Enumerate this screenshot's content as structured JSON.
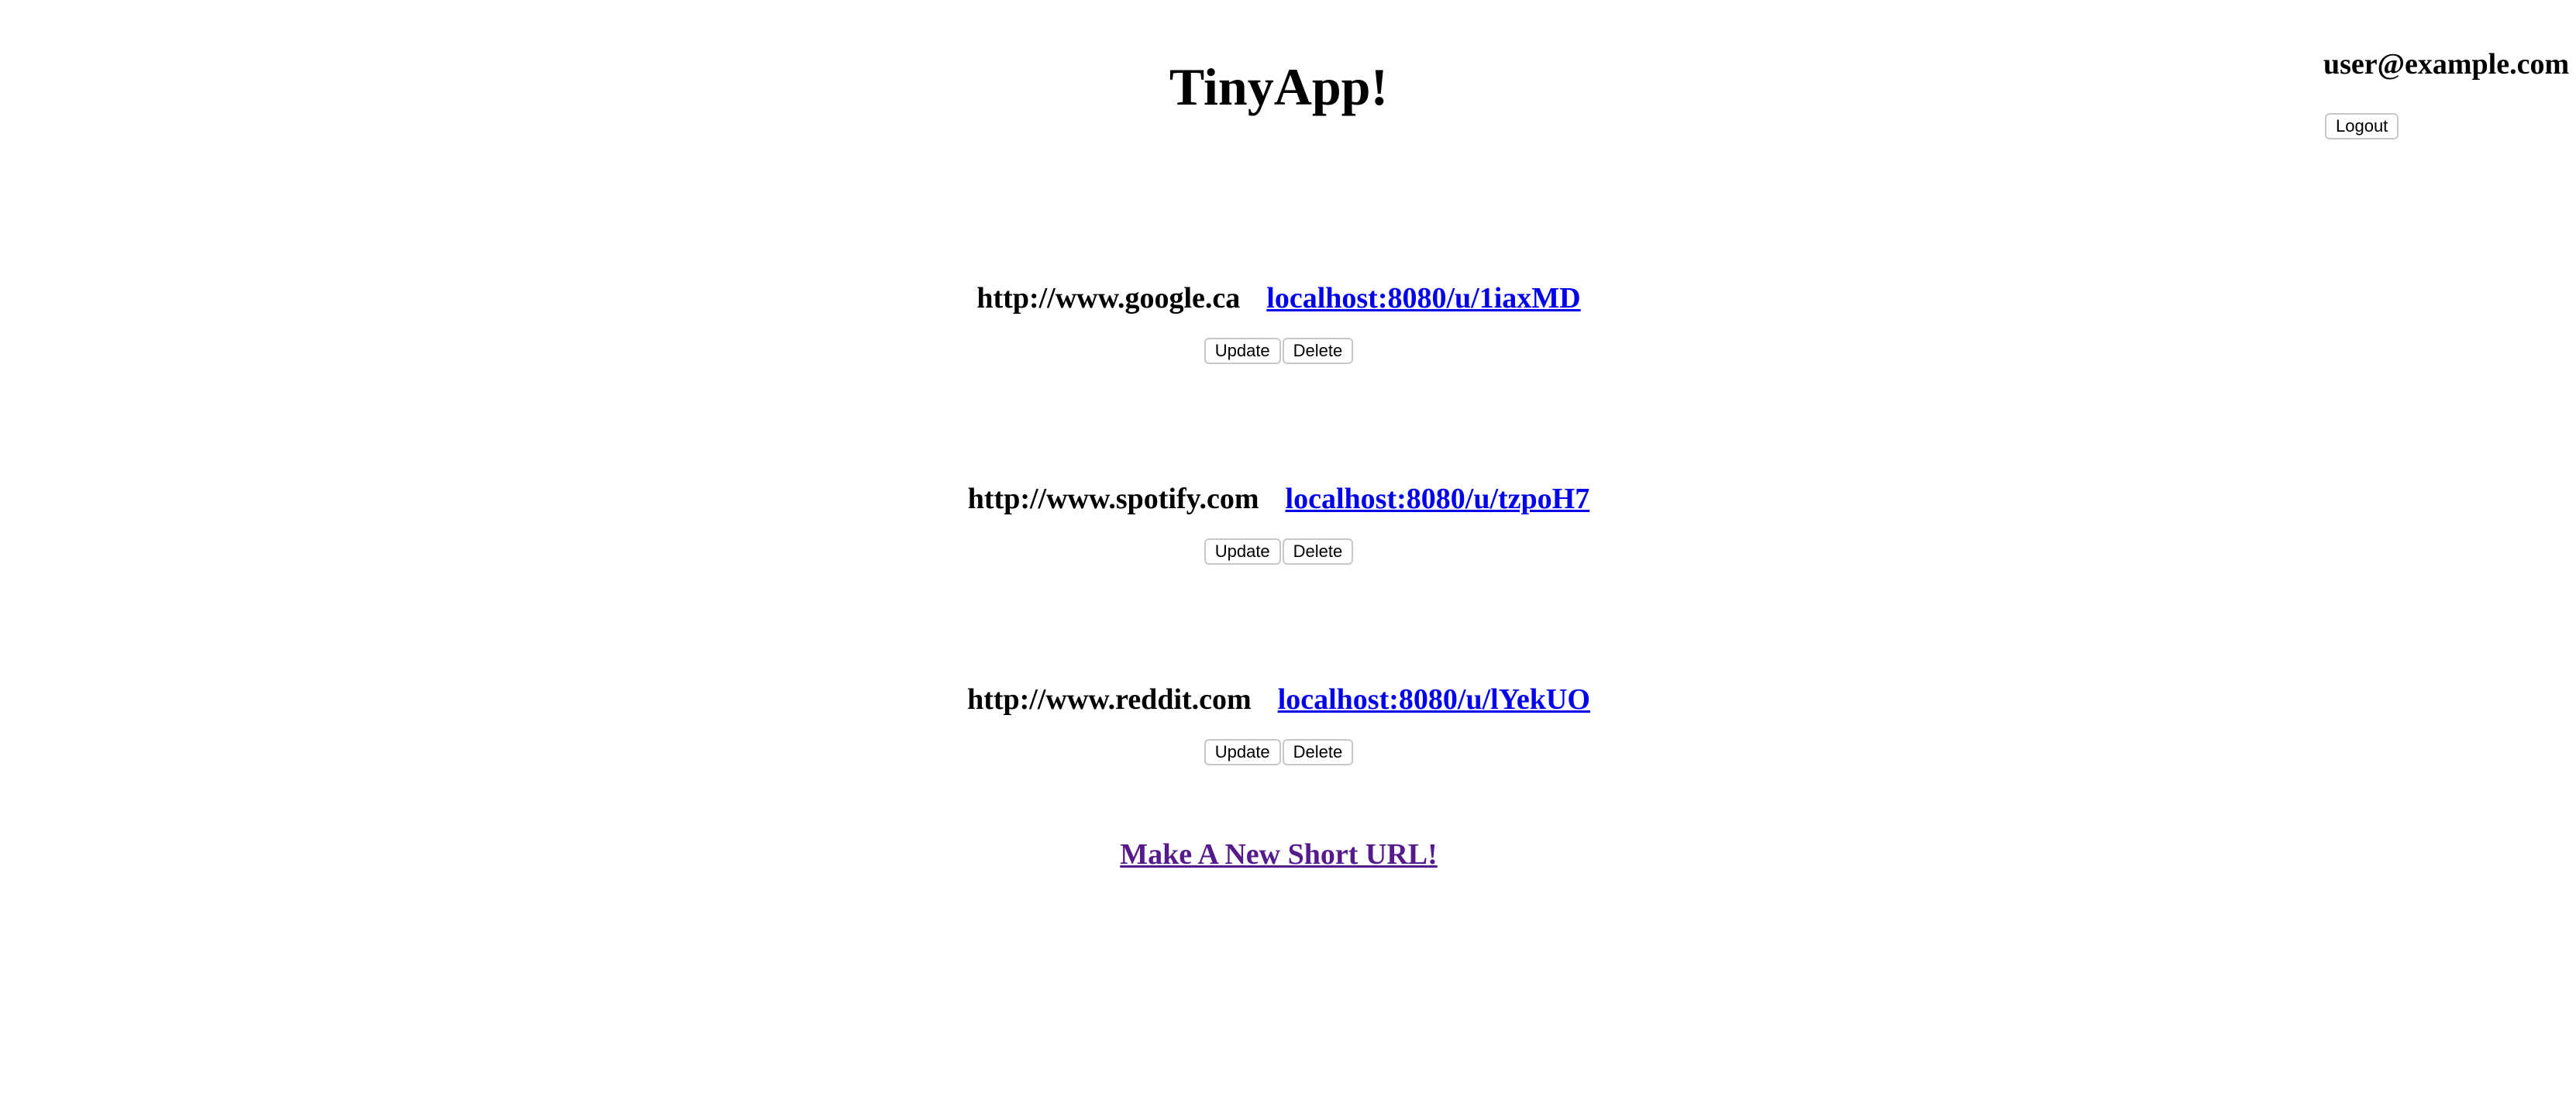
{
  "header": {
    "title": "TinyApp!"
  },
  "user": {
    "email": "user@example.com",
    "logout_label": "Logout"
  },
  "urls": [
    {
      "long_url": "http://www.google.ca",
      "short_url": "localhost:8080/u/1iaxMD",
      "update_label": "Update",
      "delete_label": "Delete"
    },
    {
      "long_url": "http://www.spotify.com",
      "short_url": "localhost:8080/u/tzpoH7",
      "update_label": "Update",
      "delete_label": "Delete"
    },
    {
      "long_url": "http://www.reddit.com",
      "short_url": "localhost:8080/u/lYekUO",
      "update_label": "Update",
      "delete_label": "Delete"
    }
  ],
  "new_url_link": "Make A New Short URL!",
  "colors": {
    "link": "#0000ee",
    "visited_link": "#551a8b"
  }
}
